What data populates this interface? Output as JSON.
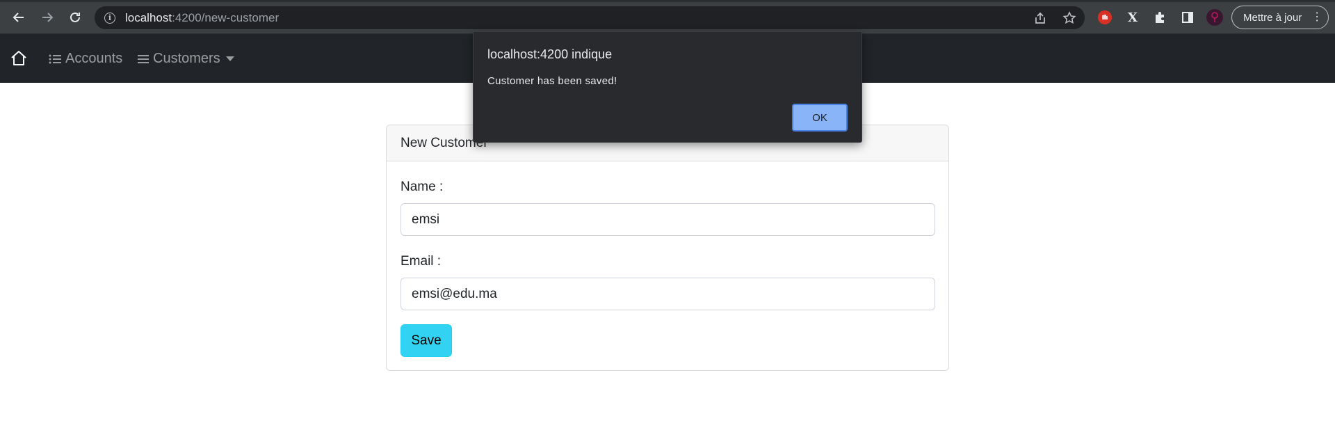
{
  "browser": {
    "url_host": "localhost",
    "url_path": ":4200/new-customer",
    "update_button_label": "Mettre à jour",
    "icons": [
      "back-icon",
      "forward-icon",
      "reload-icon",
      "info-icon",
      "share-icon",
      "star-icon",
      "extension-stop-icon",
      "extension-x-icon",
      "puzzle-icon",
      "sidebar-icon",
      "profile-avatar",
      "more-icon"
    ]
  },
  "navbar": {
    "home_icon": "home-icon",
    "accounts_label": "Accounts",
    "customers_label": "Customers"
  },
  "card": {
    "header": "New Customer",
    "name_label": "Name :",
    "name_value": "emsi",
    "email_label": "Email :",
    "email_value": "emsi@edu.ma",
    "save_label": "Save"
  },
  "dialog": {
    "title": "localhost:4200 indique",
    "message": "Customer has been saved!",
    "ok_label": "OK"
  },
  "colors": {
    "navbar_bg": "#212529",
    "save_button": "#31d2f2",
    "dialog_bg": "#292a2d",
    "ok_button": "#8ab4f8"
  }
}
